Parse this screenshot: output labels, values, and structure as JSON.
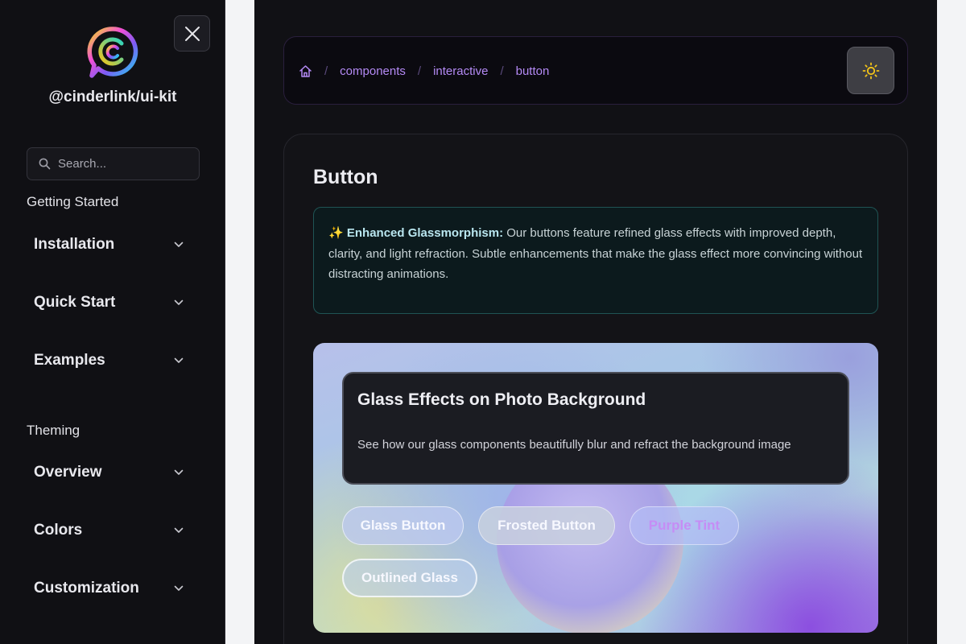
{
  "sidebar": {
    "brand": "@cinderlink/ui-kit",
    "search_placeholder": "Search...",
    "sections": [
      {
        "title": "Getting Started",
        "items": [
          {
            "label": "Installation"
          },
          {
            "label": "Quick Start"
          },
          {
            "label": "Examples"
          }
        ]
      },
      {
        "title": "Theming",
        "items": [
          {
            "label": "Overview"
          },
          {
            "label": "Colors"
          },
          {
            "label": "Customization"
          }
        ]
      }
    ]
  },
  "breadcrumb": {
    "items": [
      "components",
      "interactive",
      "button"
    ],
    "separator": "/"
  },
  "main": {
    "title": "Button",
    "notice": {
      "emoji": "✨",
      "bold": "Enhanced Glassmorphism:",
      "text": " Our buttons feature refined glass effects with improved depth, clarity, and light refraction. Subtle enhancements that make the glass effect more convincing without distracting animations."
    },
    "demo": {
      "panel_title": "Glass Effects on Photo Background",
      "panel_desc": "See how our glass components beautifully blur and refract the background image",
      "buttons": [
        "Glass Button",
        "Frosted Button",
        "Purple Tint",
        "Outlined Glass"
      ]
    }
  },
  "icons": {
    "close": "close-icon",
    "home": "home-icon",
    "search": "search-icon",
    "theme": "sun-icon",
    "chevron": "chevron-down-icon"
  },
  "colors": {
    "accent": "#b48af5",
    "sun": "#f5c518"
  }
}
